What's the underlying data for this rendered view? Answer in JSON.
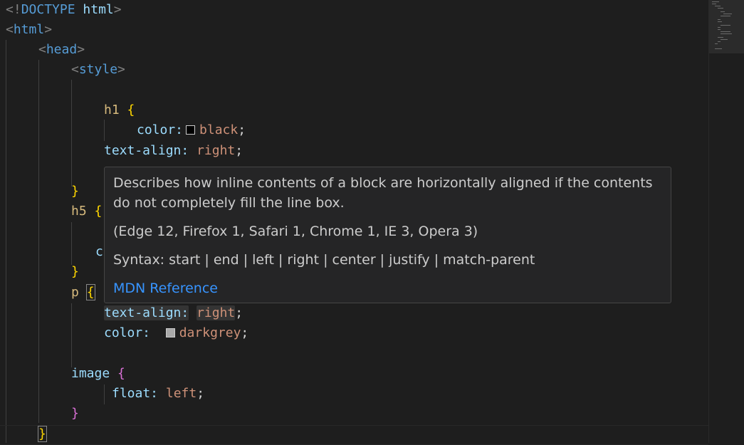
{
  "editor": {
    "lines": {
      "doctype_open": "<!",
      "doctype_kw": "DOCTYPE",
      "doctype_name": "html",
      "doctype_close": ">",
      "html_open": "<",
      "html_tag": "html",
      "html_close": ">",
      "head_open": "<",
      "head_tag": "head",
      "head_close": ">",
      "style_open": "<",
      "style_tag": "style",
      "style_close": ">",
      "h1_selector": "h1",
      "h1_brace_open": "{",
      "h1_color_prop": "color:",
      "h1_color_value": "black",
      "h1_color_semi": ";",
      "h1_align_prop": "text-align:",
      "h1_align_value": "right",
      "h1_align_semi": ";",
      "h1_brace_close": "}",
      "h5_selector": "h5",
      "h5_brace_open": "{",
      "h5_hidden_prop": "c",
      "h5_brace_close": "}",
      "p_selector": "p",
      "p_brace_open": "{",
      "p_align_prop": "text-align:",
      "p_align_value": "right",
      "p_align_semi": ";",
      "p_color_prop": "color:",
      "p_color_value": "darkgrey",
      "p_color_semi": ";",
      "image_selector": "image",
      "image_brace_open": "{",
      "image_float_prop": "float:",
      "image_float_value": "left",
      "image_float_semi": ";",
      "image_brace_close": "}",
      "final_brace": "}"
    },
    "swatches": {
      "black": "#000000",
      "darkgrey": "#a9a9a9"
    }
  },
  "hover": {
    "description": "Describes how inline contents of a block are horizontally aligned if the contents do not completely fill the line box.",
    "compatibility": "(Edge 12, Firefox 1, Safari 1, Chrome 1, IE 3, Opera 3)",
    "syntax": "Syntax: start | end | left | right | center | justify | match-parent",
    "reference_link": "MDN Reference"
  }
}
